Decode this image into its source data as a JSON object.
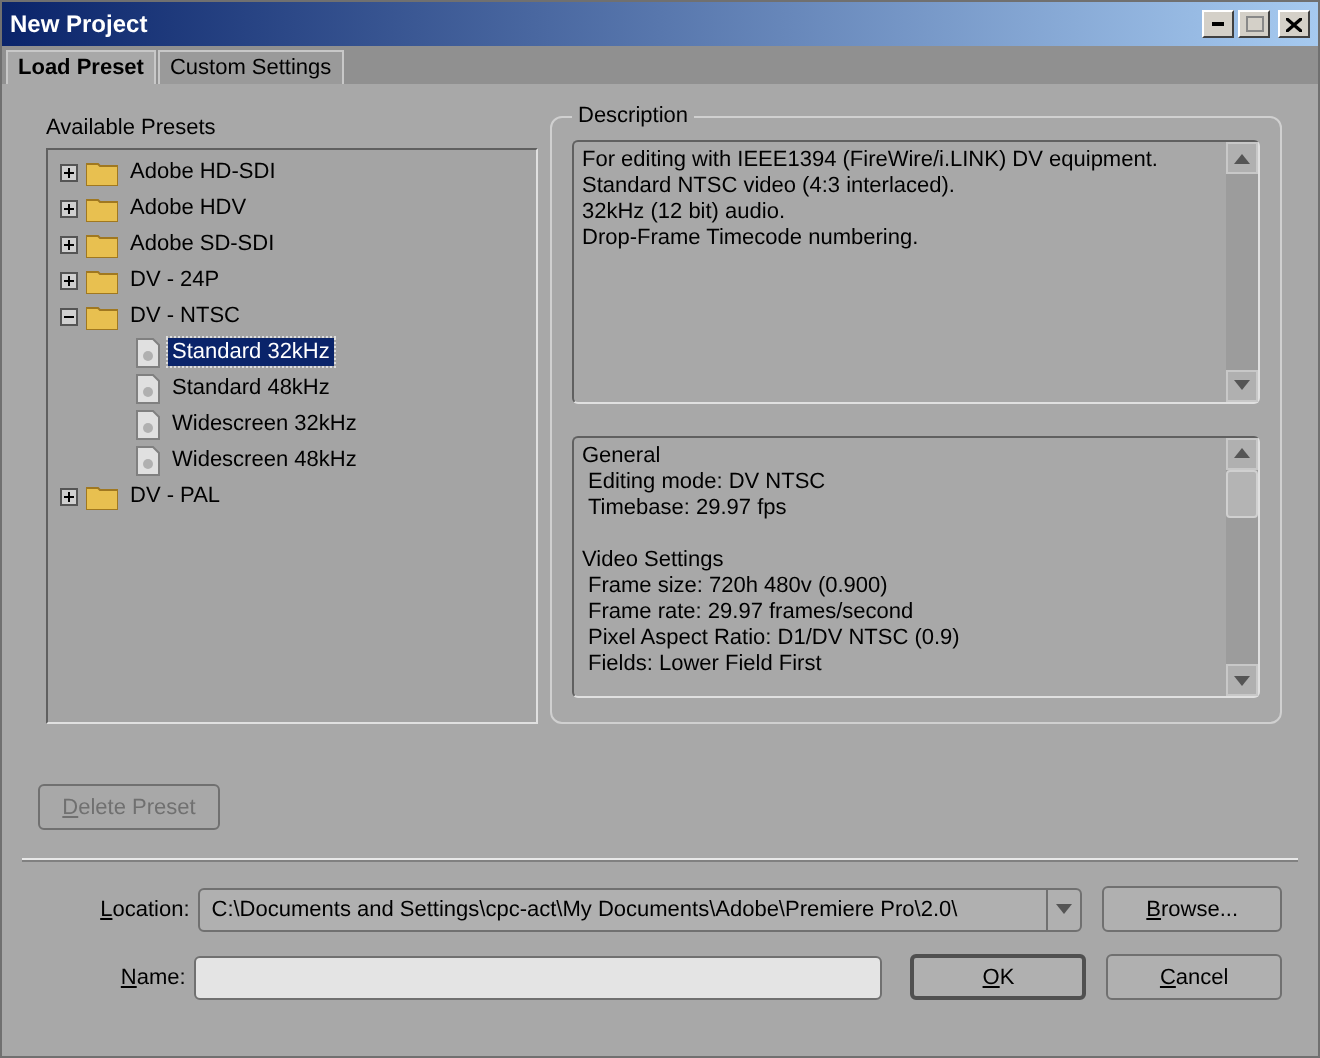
{
  "window": {
    "title": "New Project"
  },
  "tabs": [
    {
      "label": "Load Preset",
      "selected": true
    },
    {
      "label": "Custom Settings",
      "selected": false
    }
  ],
  "presets": {
    "label": "Available Presets",
    "items": [
      {
        "label": "Adobe HD-SDI",
        "expanded": false,
        "selected": false
      },
      {
        "label": "Adobe HDV",
        "expanded": false,
        "selected": false
      },
      {
        "label": "Adobe SD-SDI",
        "expanded": false,
        "selected": false
      },
      {
        "label": "DV - 24P",
        "expanded": false,
        "selected": false
      },
      {
        "label": "DV - NTSC",
        "expanded": true,
        "selected": false,
        "children": [
          {
            "label": "Standard 32kHz",
            "selected": true
          },
          {
            "label": "Standard 48kHz",
            "selected": false
          },
          {
            "label": "Widescreen 32kHz",
            "selected": false
          },
          {
            "label": "Widescreen 48kHz",
            "selected": false
          }
        ]
      },
      {
        "label": "DV - PAL",
        "expanded": false,
        "selected": false
      }
    ]
  },
  "description": {
    "label": "Description",
    "lines": [
      "For editing with IEEE1394 (FireWire/i.LINK) DV equipment.",
      "Standard NTSC video (4:3 interlaced).",
      "32kHz (12 bit) audio.",
      "Drop-Frame Timecode numbering."
    ],
    "details": [
      {
        "kind": "heading",
        "text": "General"
      },
      {
        "kind": "item",
        "text": "Editing mode: DV NTSC"
      },
      {
        "kind": "item",
        "text": "Timebase: 29.97 fps"
      },
      {
        "kind": "blank"
      },
      {
        "kind": "heading",
        "text": "Video Settings"
      },
      {
        "kind": "item",
        "text": "Frame size: 720h 480v (0.900)"
      },
      {
        "kind": "item",
        "text": "Frame rate: 29.97 frames/second"
      },
      {
        "kind": "item",
        "text": "Pixel Aspect Ratio: D1/DV NTSC (0.9)"
      },
      {
        "kind": "item",
        "text": "Fields: Lower Field First"
      }
    ]
  },
  "delete_button": {
    "label": "Delete Preset",
    "disabled": true
  },
  "location": {
    "label": "Location:",
    "value": "C:\\Documents and Settings\\cpc-act\\My Documents\\Adobe\\Premiere Pro\\2.0\\"
  },
  "browse_button": "Browse...",
  "name": {
    "label": "Name:"
  },
  "ok_button": "OK",
  "cancel_button": "Cancel"
}
